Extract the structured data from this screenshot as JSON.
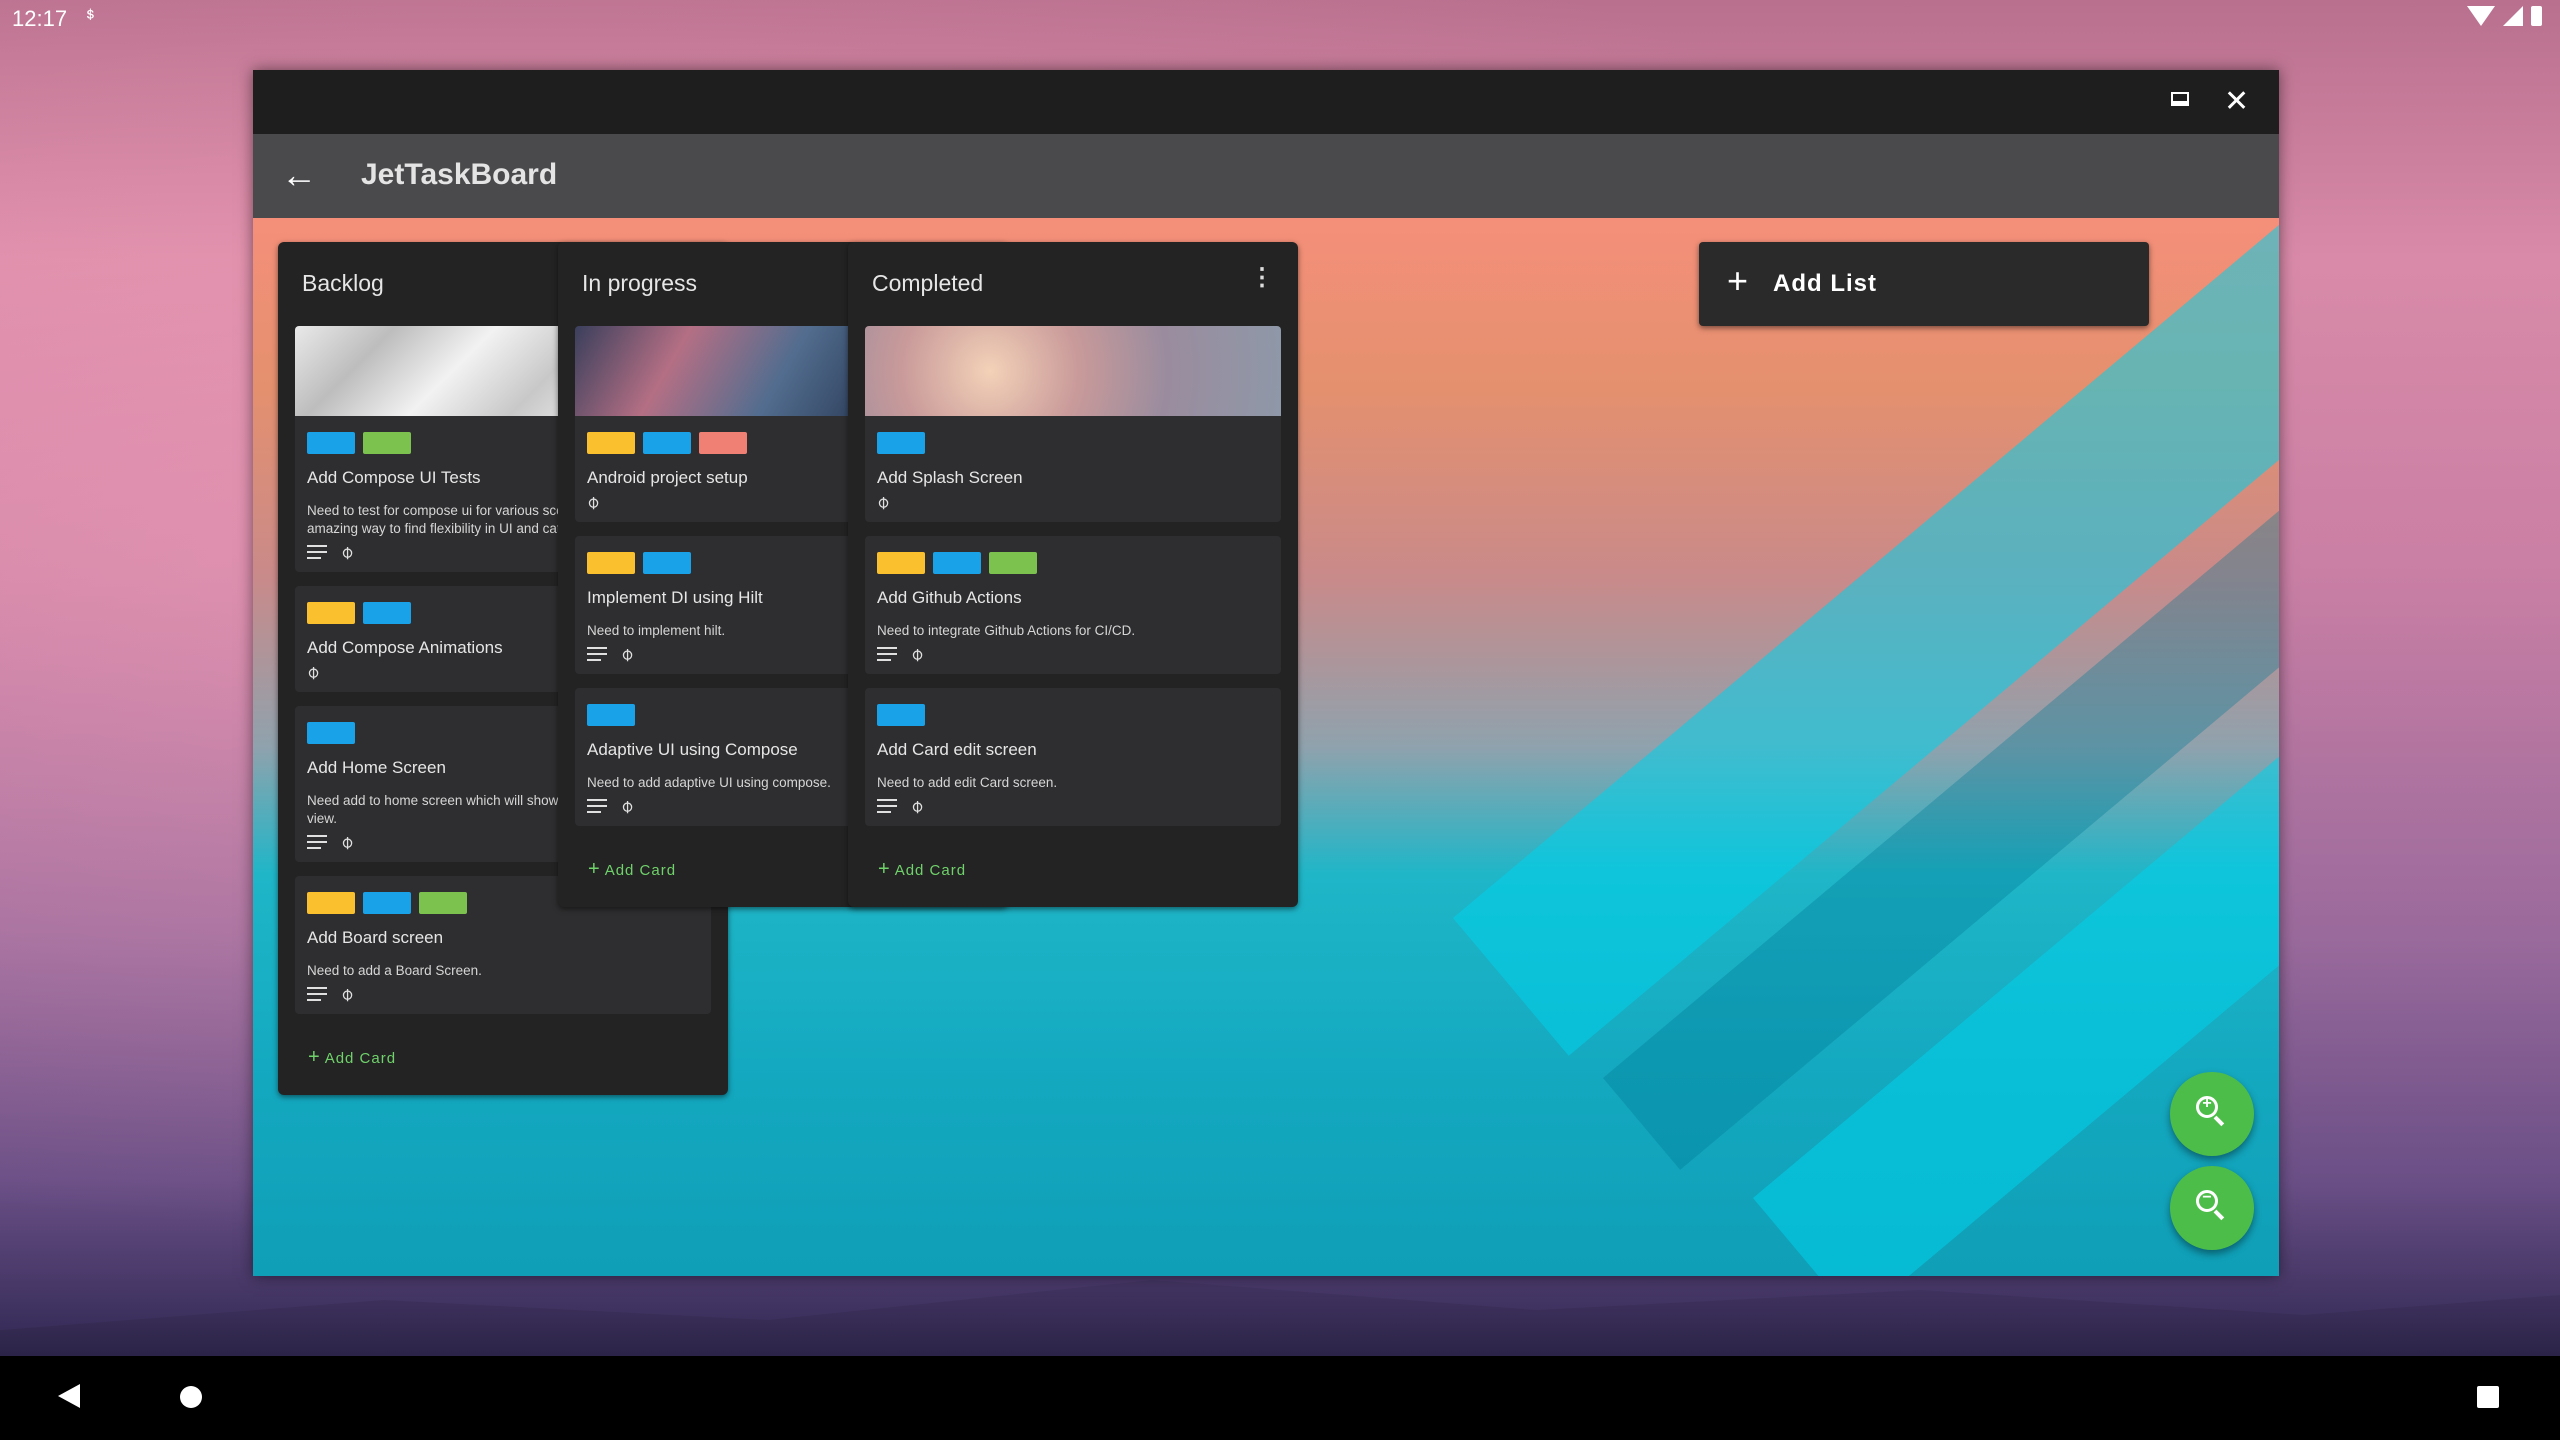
{
  "status_bar": {
    "time": "12:17"
  },
  "app": {
    "title": "JetTaskBoard"
  },
  "colors": {
    "blue": "#19a2e8",
    "yellow": "#fbc02d",
    "green": "#7cc24e",
    "salmon": "#f07f74",
    "accent": "#4dbd4a"
  },
  "lists": [
    {
      "title": "Backlog",
      "add_card_label": "Add Card",
      "cards": [
        {
          "title": "Add Compose UI Tests",
          "description": "Need to test for compose ui for various scenarios. Tests are an amazing way to find flexibility in UI and catch early...",
          "labels": [
            "blue",
            "green"
          ],
          "has_cover": true
        },
        {
          "title": "Add Compose Animations",
          "description": "",
          "labels": [
            "yellow",
            "blue"
          ]
        },
        {
          "title": "Add Home Screen",
          "description": "Need add to home screen which will show a list of items in a grid view.",
          "labels": [
            "blue"
          ]
        },
        {
          "title": "Add Board screen",
          "description": "Need to add a Board Screen.",
          "labels": [
            "yellow",
            "blue",
            "green"
          ]
        }
      ]
    },
    {
      "title": "In progress",
      "add_card_label": "Add Card",
      "cards": [
        {
          "title": "Android project setup",
          "description": "",
          "labels": [
            "yellow",
            "blue",
            "salmon"
          ],
          "has_cover": true
        },
        {
          "title": "Implement DI using Hilt",
          "description": "Need to implement hilt.",
          "labels": [
            "yellow",
            "blue"
          ]
        },
        {
          "title": "Adaptive UI using Compose",
          "description": "Need to add adaptive UI using compose.",
          "labels": [
            "blue"
          ]
        }
      ]
    },
    {
      "title": "Completed",
      "add_card_label": "Add Card",
      "cards": [
        {
          "title": "Add Splash Screen",
          "description": "",
          "labels": [
            "blue"
          ],
          "has_cover": true
        },
        {
          "title": "Add Github Actions",
          "description": "Need to integrate Github Actions for CI/CD.",
          "labels": [
            "yellow",
            "blue",
            "green"
          ]
        },
        {
          "title": "Add Card edit screen",
          "description": "Need to add edit Card screen.",
          "labels": [
            "blue"
          ]
        }
      ]
    }
  ],
  "add_list_label": "Add List",
  "fabs": {
    "zoom_in": "+",
    "zoom_out": "−"
  }
}
